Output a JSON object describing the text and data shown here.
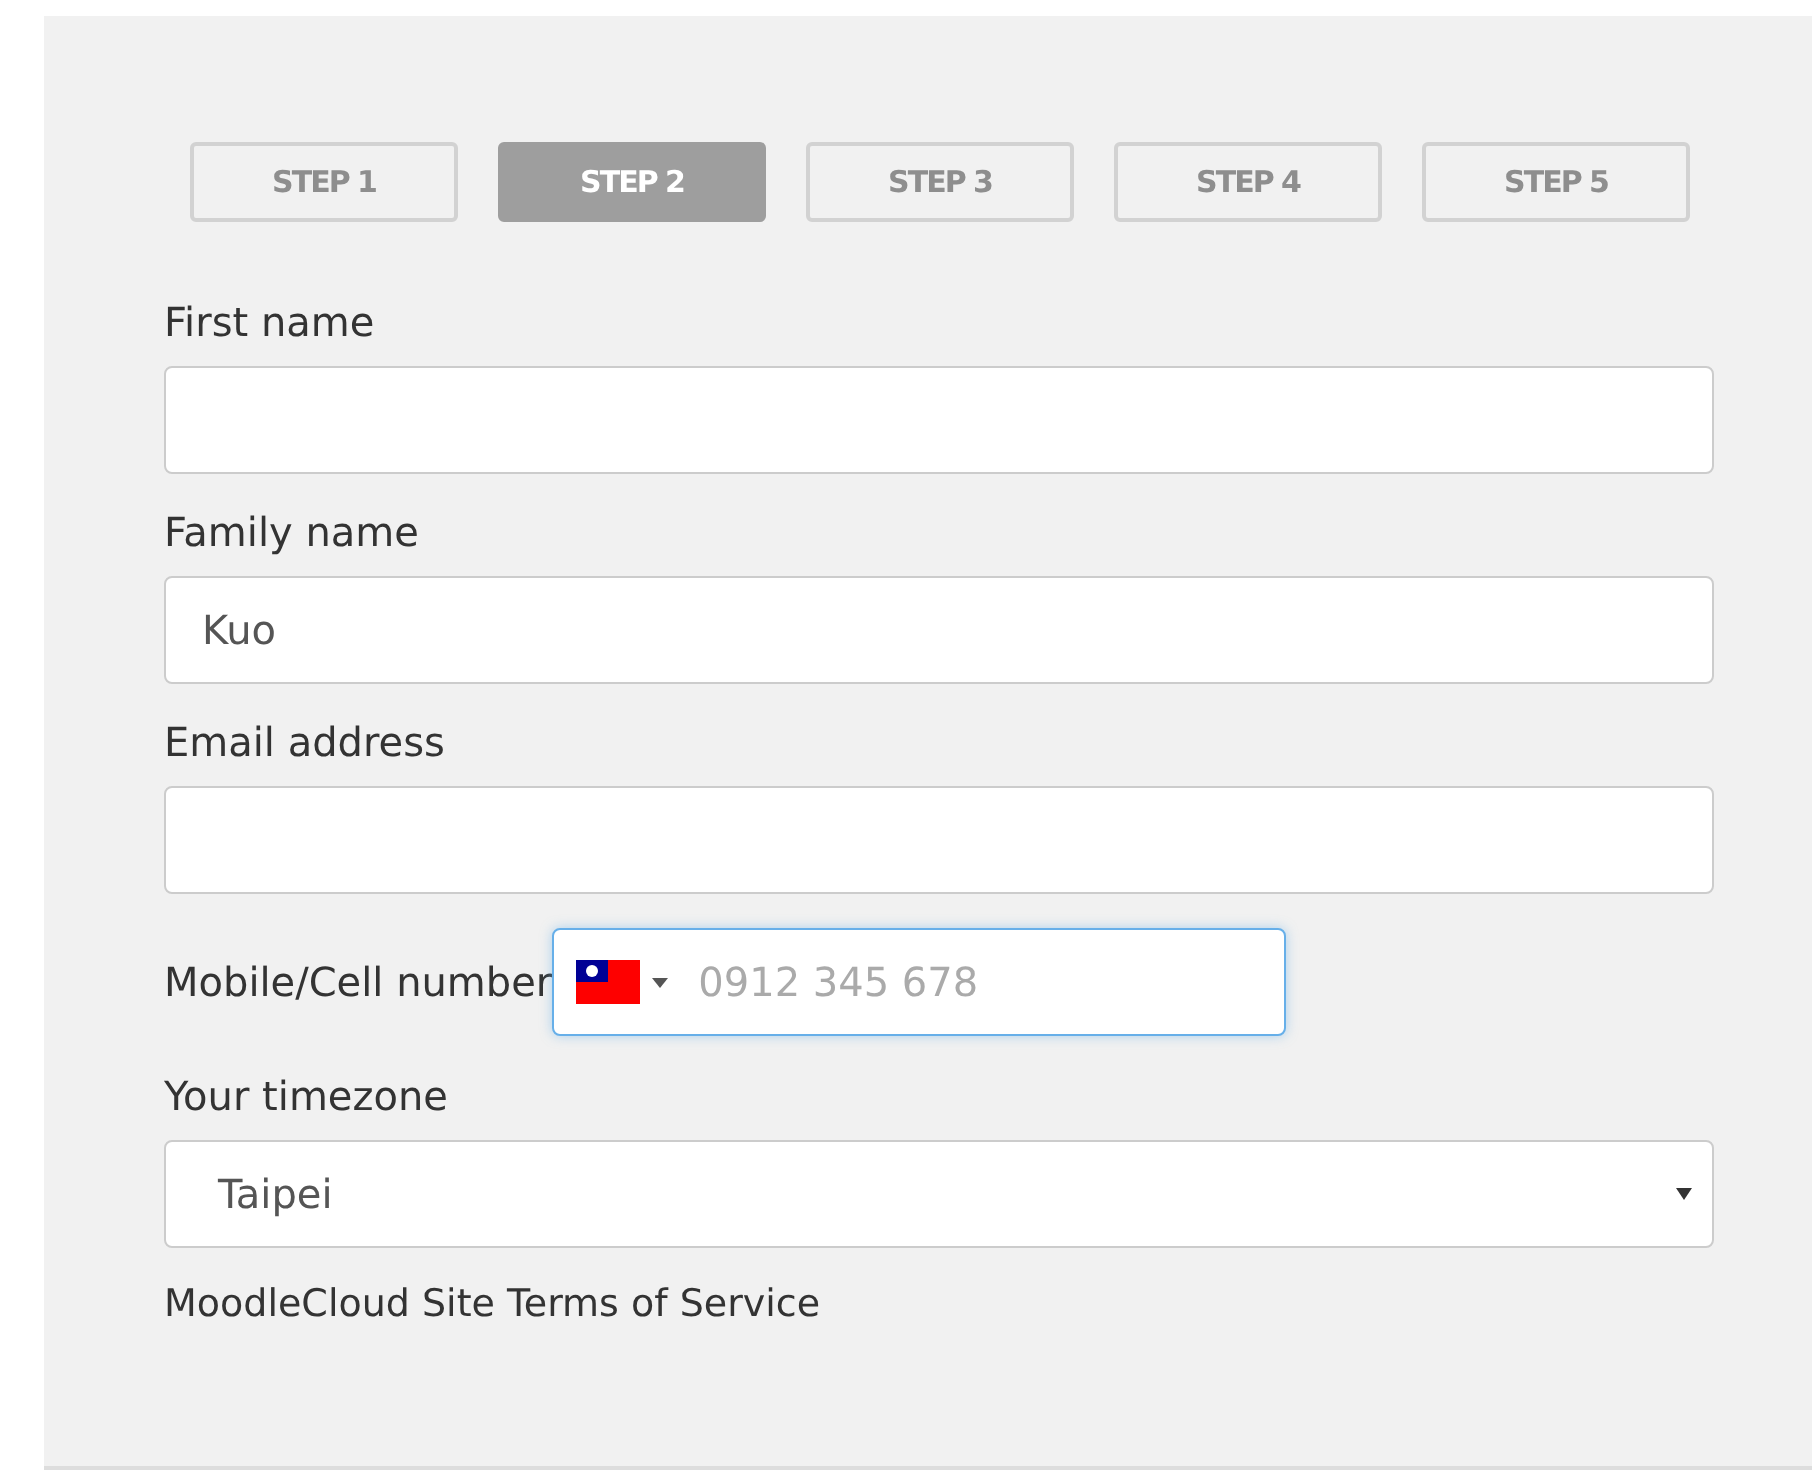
{
  "steps": [
    {
      "label": "STEP 1",
      "selected": false
    },
    {
      "label": "STEP 2",
      "selected": true
    },
    {
      "label": "STEP 3",
      "selected": false
    },
    {
      "label": "STEP 4",
      "selected": false
    },
    {
      "label": "STEP 5",
      "selected": false
    }
  ],
  "fields": [
    {
      "kind": "text",
      "label": "First name"
    },
    {
      "kind": "text",
      "label": "Family name",
      "value": "Kuo"
    },
    {
      "kind": "text",
      "label": "Email address"
    },
    {
      "kind": "phone",
      "label": "Mobile/Cell number",
      "placeholder": "0912 345 678"
    },
    {
      "kind": "select",
      "label": "Your timezone",
      "value": "Taipei"
    }
  ],
  "terms_heading": "MoodleCloud Site Terms of Service"
}
